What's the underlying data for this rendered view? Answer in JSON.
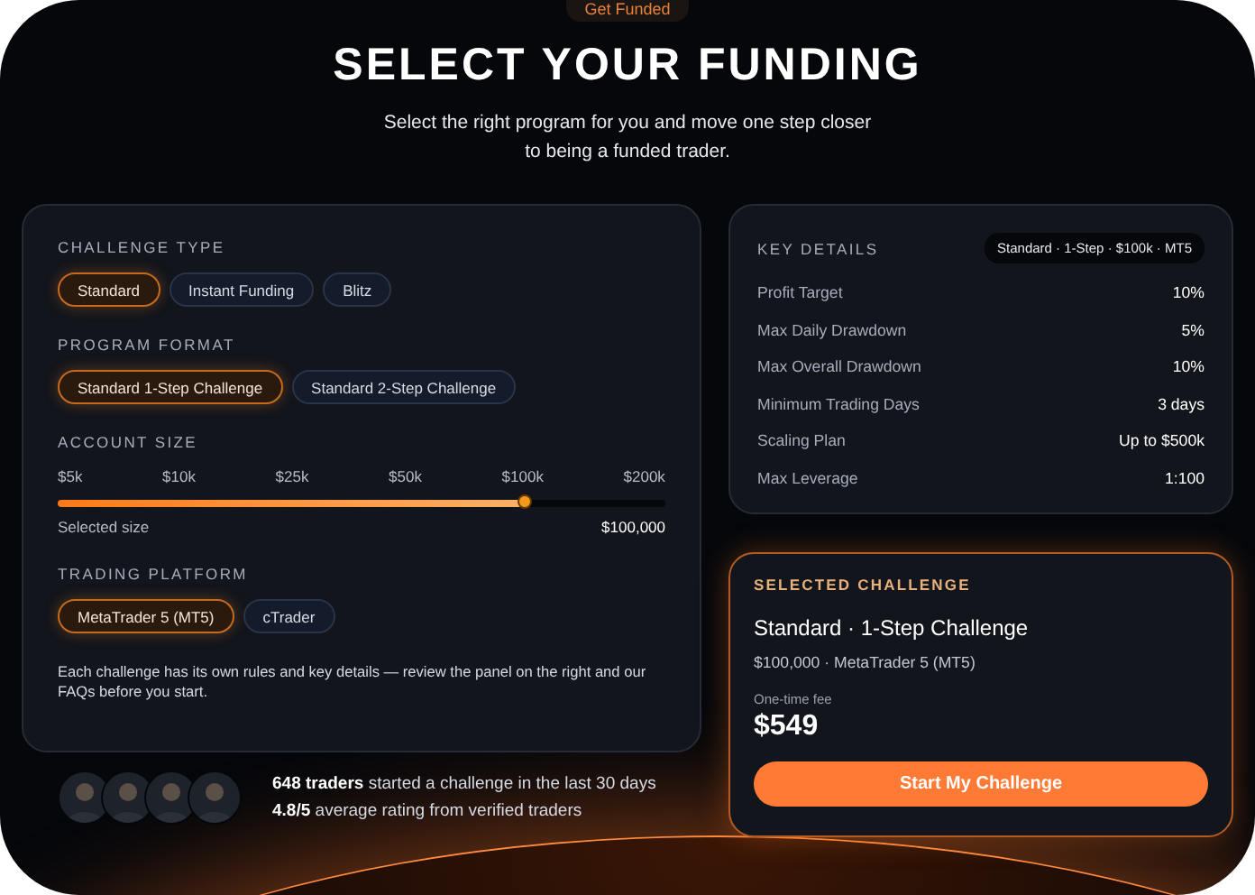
{
  "badge": "Get Funded",
  "title": "SELECT YOUR FUNDING",
  "subtitle": "Select the right program for you and move one step closer to being a funded trader.",
  "sections": [
    {
      "kind": "options",
      "label": "CHALLENGE TYPE",
      "options": [
        {
          "label": "Standard",
          "selected": true
        },
        {
          "label": "Instant Funding",
          "selected": false
        },
        {
          "label": "Blitz",
          "selected": false
        }
      ]
    },
    {
      "kind": "options",
      "label": "PROGRAM FORMAT",
      "options": [
        {
          "label": "Standard 1-Step Challenge",
          "selected": true
        },
        {
          "label": "Standard 2-Step Challenge",
          "selected": false
        }
      ]
    },
    {
      "kind": "slider",
      "label": "ACCOUNT SIZE",
      "ticks": [
        "$5k",
        "$10k",
        "$25k",
        "$50k",
        "$100k",
        "$200k"
      ],
      "level": 0.77,
      "caption": "Selected size",
      "value": "$100,000"
    },
    {
      "kind": "options",
      "label": "TRADING PLATFORM",
      "options": [
        {
          "label": "MetaTrader 5 (MT5)",
          "selected": true
        },
        {
          "label": "cTrader",
          "selected": false
        }
      ]
    }
  ],
  "note": "Each challenge has its own rules and key details — review the panel on the right and our FAQs before you start.",
  "social": {
    "lines": [
      "**648 traders** started a challenge in the last 30 days",
      "**4.8/5** average rating from verified traders"
    ]
  },
  "key_details": {
    "title": "KEY DETAILS",
    "tag": "Standard · 1-Step · $100k · MT5",
    "rows": [
      {
        "label": "Profit Target",
        "value": "10%"
      },
      {
        "label": "Max Daily Drawdown",
        "value": "5%"
      },
      {
        "label": "Max Overall Drawdown",
        "value": "10%"
      },
      {
        "label": "Minimum Trading Days",
        "value": "3 days"
      },
      {
        "label": "Scaling Plan",
        "value": "Up to $500k"
      },
      {
        "label": "Max Leverage",
        "value": "1:100"
      }
    ]
  },
  "selected_challenge": {
    "heading": "SELECTED CHALLENGE",
    "name": "Standard · 1-Step Challenge",
    "summary": "$100,000 · MetaTrader 5 (MT5)",
    "fee_label": "One-time fee",
    "price": "$549",
    "button": "Start My Challenge"
  }
}
